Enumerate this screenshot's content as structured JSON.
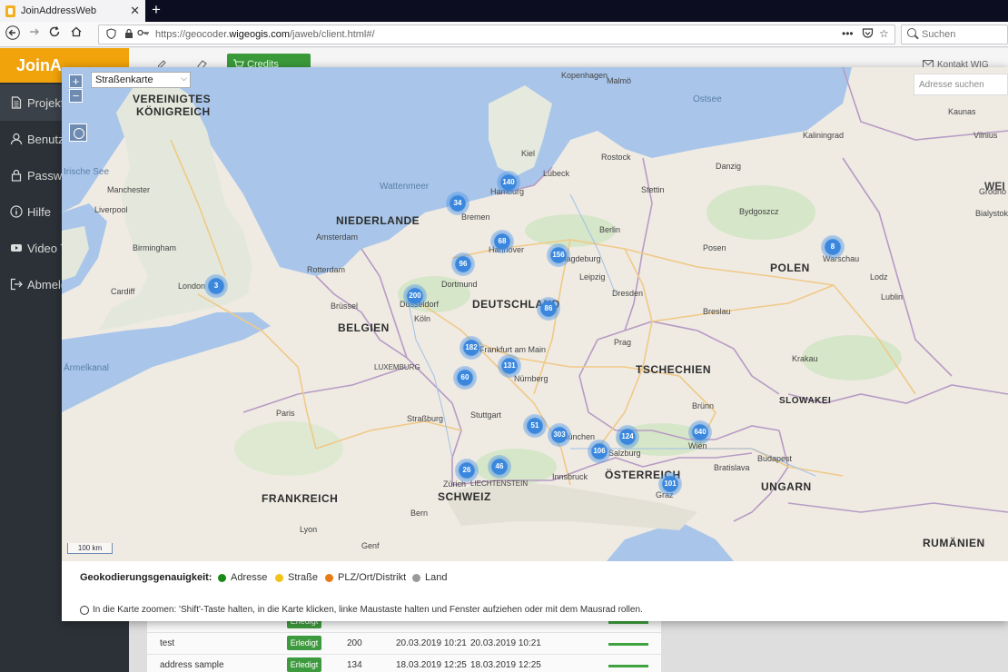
{
  "browser": {
    "tab_title": "JoinAddressWeb",
    "tab_close": "✕",
    "new_tab": "+",
    "url_prefix": "https://geocoder.",
    "url_domain": "wigeogis.com",
    "url_path": "/jaweb/client.html#/",
    "search_placeholder": "Suchen"
  },
  "app": {
    "logo": "JoinA",
    "credits_button": "Credits kaufen",
    "kontakt": "Kontakt WIG",
    "sidebar": [
      {
        "label": "Projekte",
        "icon": "document-icon"
      },
      {
        "label": "Benutze",
        "icon": "user-icon"
      },
      {
        "label": "Passwo",
        "icon": "lock-icon"
      },
      {
        "label": "Hilfe",
        "icon": "info-icon"
      },
      {
        "label": "Video T",
        "icon": "youtube-icon"
      },
      {
        "label": "Abmeld",
        "icon": "logout-icon"
      }
    ],
    "rows": [
      {
        "name": "",
        "status": "Erledigt",
        "count": "",
        "date1": "",
        "date2": ""
      },
      {
        "name": "test",
        "status": "Erledigt",
        "count": "200",
        "date1": "20.03.2019 10:21",
        "date2": "20.03.2019 10:21"
      },
      {
        "name": "address sample",
        "status": "Erledigt",
        "count": "134",
        "date1": "18.03.2019 12:25",
        "date2": "18.03.2019 12:25"
      }
    ]
  },
  "map": {
    "layer_select": "Straßenkarte",
    "address_search_placeholder": "Adresse suchen",
    "scale": "100 km",
    "zoom_in": "+",
    "zoom_out": "−",
    "countries": [
      {
        "text": "VEREINIGTES",
        "key": "uk1"
      },
      {
        "text": "KÖNIGREICH",
        "key": "uk2"
      },
      {
        "text": "NIEDERLANDE",
        "key": "nl"
      },
      {
        "text": "BELGIEN",
        "key": "be"
      },
      {
        "text": "DEUTSCHLAND",
        "key": "de"
      },
      {
        "text": "POLEN",
        "key": "pl"
      },
      {
        "text": "TSCHECHIEN",
        "key": "cz"
      },
      {
        "text": "SLOWAKEI",
        "key": "sk"
      },
      {
        "text": "ÖSTERREICH",
        "key": "at"
      },
      {
        "text": "SCHWEIZ",
        "key": "ch"
      },
      {
        "text": "FRANKREICH",
        "key": "fr"
      },
      {
        "text": "UNGARN",
        "key": "hu"
      },
      {
        "text": "RUMÄNIEN",
        "key": "ro"
      },
      {
        "text": "LUXEMBURG",
        "key": "lu"
      },
      {
        "text": "LIECHTENSTEIN",
        "key": "li"
      }
    ],
    "seas": [
      "Ostsee",
      "Wattenmeer",
      "Irische See",
      "Ärmelkanal"
    ],
    "cities": [
      "Hamburg",
      "Bremen",
      "Hannover",
      "Berlin",
      "Magdeburg",
      "Dortmund",
      "Düsseldorf",
      "Köln",
      "Frankfurt am Main",
      "Nürnberg",
      "Stuttgart",
      "München",
      "Wien",
      "Warschau",
      "Prag",
      "London",
      "Paris",
      "Amsterdam",
      "Brüssel",
      "Budapest",
      "Krakau",
      "Breslau",
      "Posen",
      "Dresden",
      "Leipzig",
      "Kiel",
      "Danzig",
      "Zürich",
      "Bern",
      "Genf",
      "Lyon",
      "Straßburg",
      "Salzburg",
      "Graz",
      "Innsbruck",
      "Bratislava",
      "Brünn",
      "Birmingham",
      "Manchester",
      "Liverpool",
      "Cardiff",
      "Rotterdam",
      "Lübeck",
      "Rostock",
      "Kopenhagen",
      "Malmö",
      "Lodz",
      "Lublin",
      "Kaunas",
      "Vilnius",
      "Grodno",
      "Bialystok",
      "Kaliningrad",
      "Stettin",
      "Bydgoszcz"
    ],
    "clusters": [
      {
        "count": "140",
        "key": "hh"
      },
      {
        "count": "34",
        "key": "hb"
      },
      {
        "count": "68",
        "key": "ha"
      },
      {
        "count": "156",
        "key": "md"
      },
      {
        "count": "96",
        "key": "bi"
      },
      {
        "count": "200",
        "key": "du"
      },
      {
        "count": "86",
        "key": "le"
      },
      {
        "count": "3",
        "key": "lo"
      },
      {
        "count": "182",
        "key": "fr"
      },
      {
        "count": "131",
        "key": "nu"
      },
      {
        "count": "60",
        "key": "ka"
      },
      {
        "count": "51",
        "key": "au"
      },
      {
        "count": "303",
        "key": "mu"
      },
      {
        "count": "124",
        "key": "li"
      },
      {
        "count": "640",
        "key": "wi"
      },
      {
        "count": "106",
        "key": "sa"
      },
      {
        "count": "46",
        "key": "bo"
      },
      {
        "count": "26",
        "key": "zu"
      },
      {
        "count": "101",
        "key": "gr"
      },
      {
        "count": "8",
        "key": "wa"
      }
    ]
  },
  "legend": {
    "title": "Geokodierungsgenauigkeit:",
    "items": [
      {
        "label": "Adresse",
        "color": "#1a8a1a"
      },
      {
        "label": "Straße",
        "color": "#f2c318"
      },
      {
        "label": "PLZ/Ort/Distrikt",
        "color": "#e87b14"
      },
      {
        "label": "Land",
        "color": "#9a9a9a"
      }
    ],
    "hint": "In die Karte zoomen: 'Shift'-Taste halten, in die Karte klicken, linke Maustaste halten und Fenster aufziehen oder mit dem Mausrad rollen."
  }
}
